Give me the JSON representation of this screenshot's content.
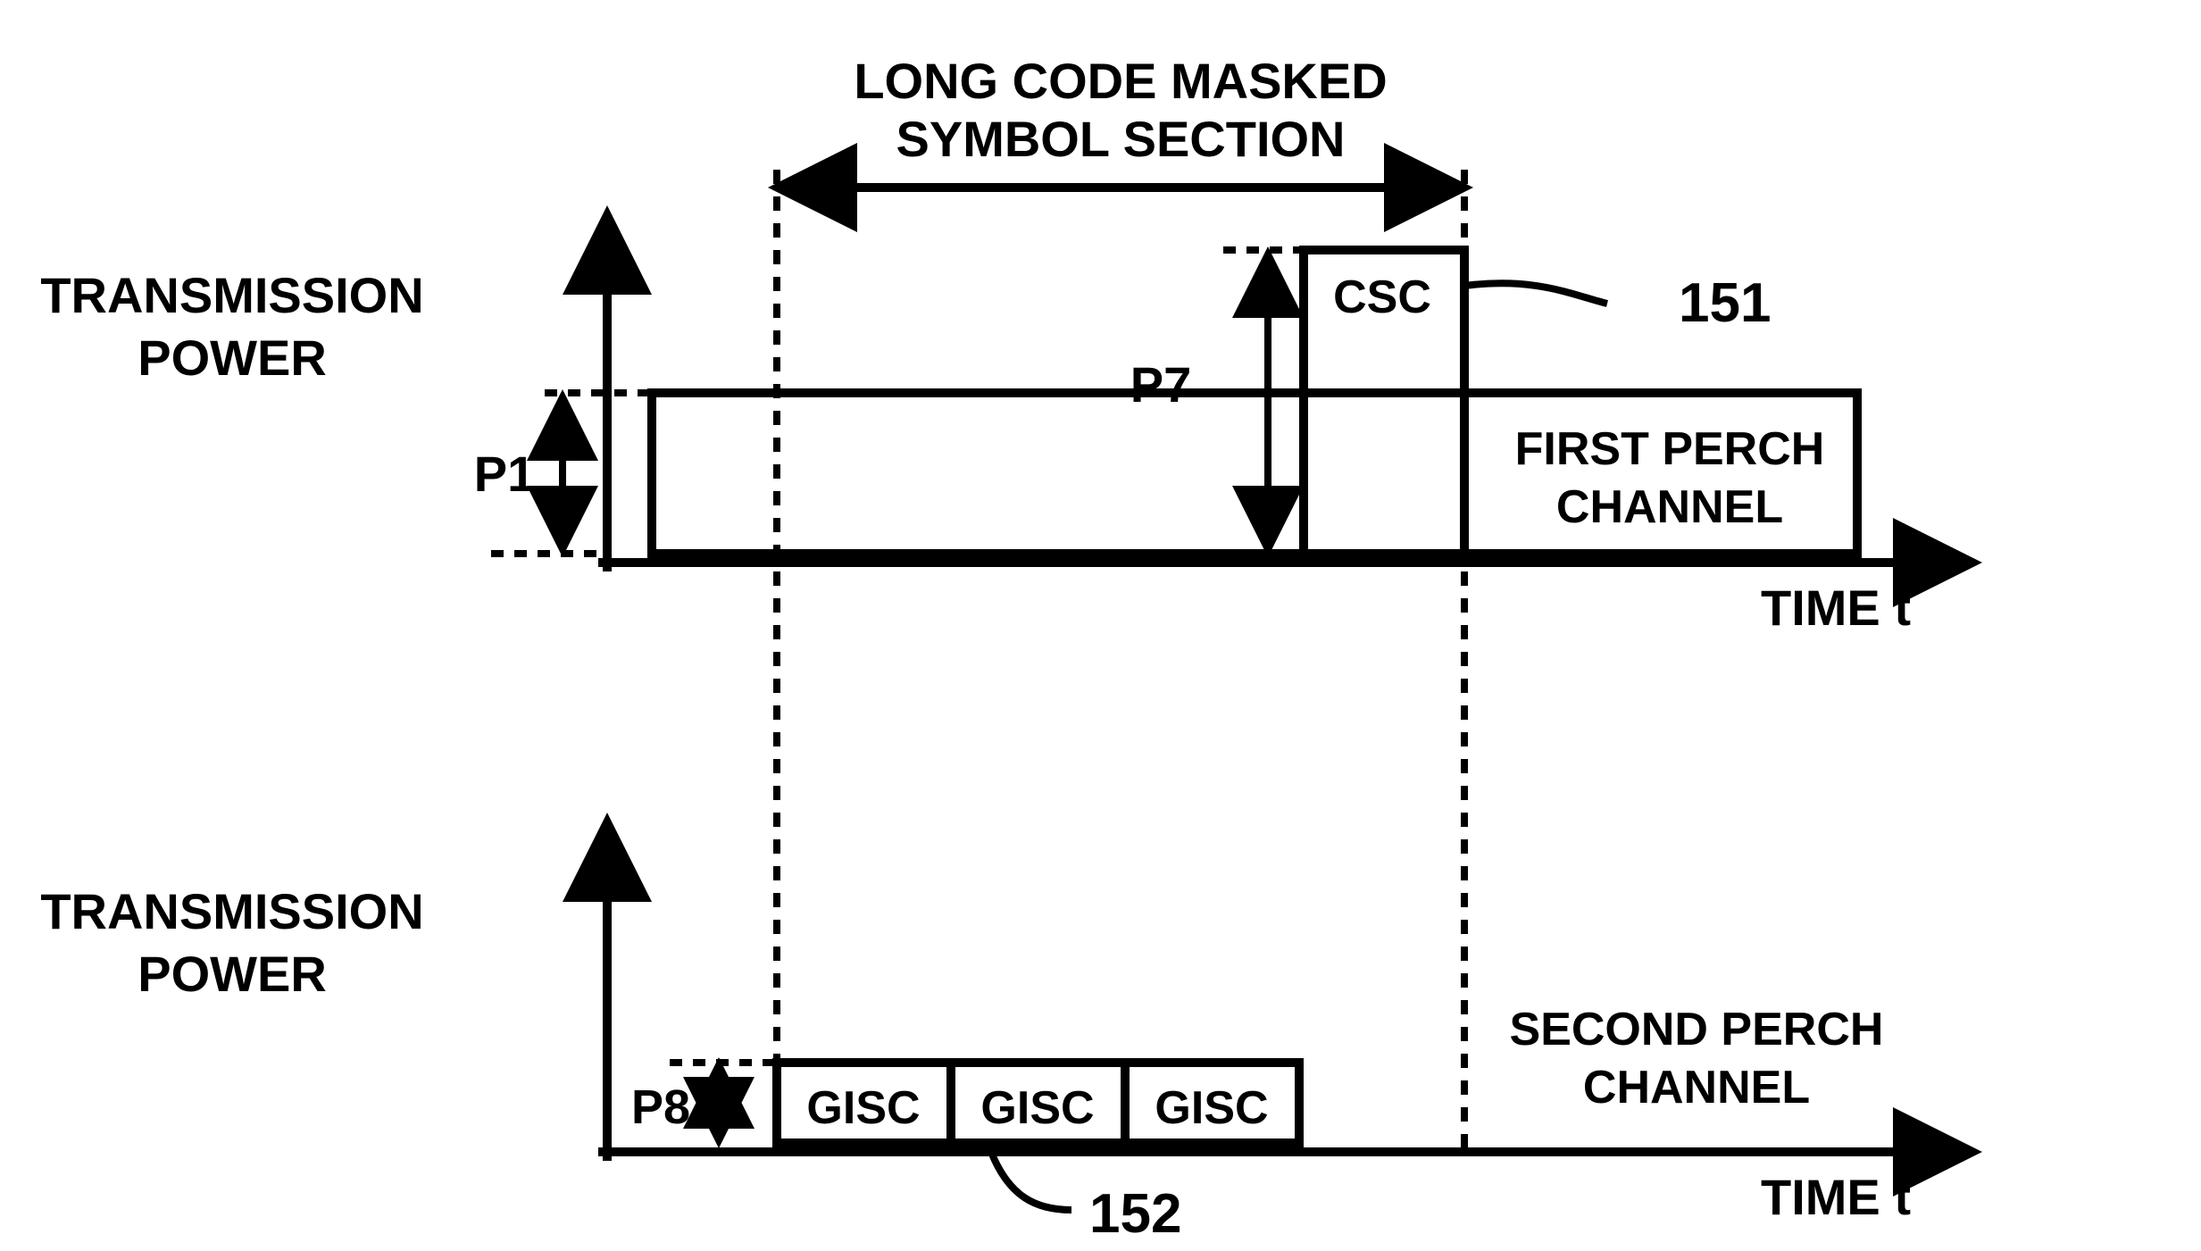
{
  "chart_data": [
    {
      "type": "bar",
      "title": "",
      "xlabel": "TIME t",
      "ylabel": "TRANSMISSION POWER",
      "series": [
        {
          "name": "First Perch Channel baseline",
          "value_label": "P1"
        },
        {
          "name": "CSC block height",
          "value_label": "P7"
        }
      ]
    },
    {
      "type": "bar",
      "title": "",
      "xlabel": "TIME t",
      "ylabel": "TRANSMISSION POWER",
      "series": [
        {
          "name": "GISC block height",
          "value_label": "P8"
        }
      ]
    }
  ],
  "labels": {
    "section": {
      "line1": "LONG CODE MASKED",
      "line2": "SYMBOL SECTION"
    },
    "yaxis": {
      "line1": "TRANSMISSION",
      "line2": "POWER"
    },
    "xaxis": "TIME t",
    "p1": "P1",
    "p7": "P7",
    "p8": "P8",
    "csc": "CSC",
    "gisc": "GISC",
    "first_perch": {
      "l1": "FIRST PERCH",
      "l2": "CHANNEL"
    },
    "second_perch": {
      "l1": "SECOND PERCH",
      "l2": "CHANNEL"
    },
    "num151": "151",
    "num152": "152"
  }
}
